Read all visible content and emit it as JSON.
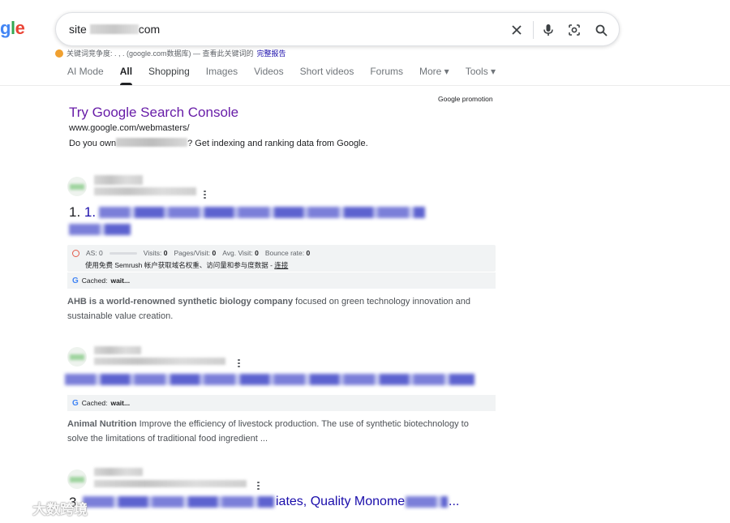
{
  "logo": {
    "text_part1": "g",
    "text_part2": "l",
    "text_part3": "e"
  },
  "search": {
    "query_prefix": "site",
    "query_suffix": "com"
  },
  "extension_line": {
    "text": "关键词竞争度: . , .  (google.com数据库) — 查看此关键词的",
    "link": "完整报告"
  },
  "tabs": [
    {
      "label": "AI Mode"
    },
    {
      "label": "All"
    },
    {
      "label": "Shopping"
    },
    {
      "label": "Images"
    },
    {
      "label": "Videos"
    },
    {
      "label": "Short videos"
    },
    {
      "label": "Forums"
    },
    {
      "label": "More ▾"
    },
    {
      "label": "Tools ▾"
    }
  ],
  "promo": {
    "label": "Google promotion",
    "title": "Try Google Search Console",
    "url": "www.google.com/webmasters/",
    "desc_prefix": "Do you own",
    "desc_suffix": "? Get indexing and ranking data from Google."
  },
  "results": [
    {
      "num_prefix": "1. ",
      "num_blue": "1.",
      "semrush": {
        "as": "AS: 0",
        "visits_label": "Visits:",
        "visits": "0",
        "pages_label": "Pages/Visit:",
        "pages": "0",
        "avg_label": "Avg. Visit:",
        "avg": "0",
        "bounce_label": "Bounce rate:",
        "bounce": "0",
        "promo_text": "使用免费 Semrush 帐户获取域名权重、访问量和参与度数据 - ",
        "promo_link": "连接"
      },
      "cached_label": "Cached:",
      "cached_value": "wait...",
      "snippet_bold": "AHB is a world-renowned synthetic biology company",
      "snippet_rest": " focused on green technology innovation and sustainable value creation."
    },
    {
      "cached_label": "Cached:",
      "cached_value": "wait...",
      "snippet_bold": "Animal Nutrition",
      "snippet_rest": " Improve the efficiency of livestock production. The use of synthetic biotechnology to solve the limitations of traditional food ingredient ..."
    },
    {
      "num_prefix": "3.",
      "title_visible": "iates, Quality Monome",
      "title_ellipsis": "..."
    }
  ],
  "watermark": "大数跨境"
}
